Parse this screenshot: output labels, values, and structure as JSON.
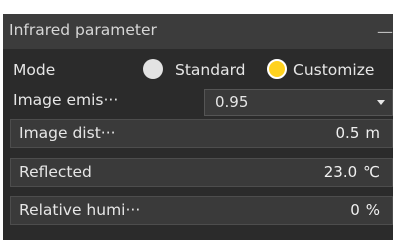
{
  "panel": {
    "title": "Infrared parameter",
    "collapse_icon": "minus-icon"
  },
  "mode": {
    "label": "Mode",
    "options": [
      {
        "label": "Standard",
        "selected": false
      },
      {
        "label": "Customize",
        "selected": true
      }
    ]
  },
  "emissivity": {
    "label": "Image emis···",
    "value": "0.95"
  },
  "fields": [
    {
      "label": "Image dist···",
      "value": "0.5",
      "unit": "m"
    },
    {
      "label": "Reflected",
      "value": "23.0",
      "unit": "℃"
    },
    {
      "label": "Relative humi···",
      "value": "0",
      "unit": "%"
    }
  ],
  "colors": {
    "panel_bg": "#2b2b2b",
    "title_bg": "#3c3c3c",
    "field_bg": "#3a3a3a",
    "accent": "#ffd21f"
  }
}
